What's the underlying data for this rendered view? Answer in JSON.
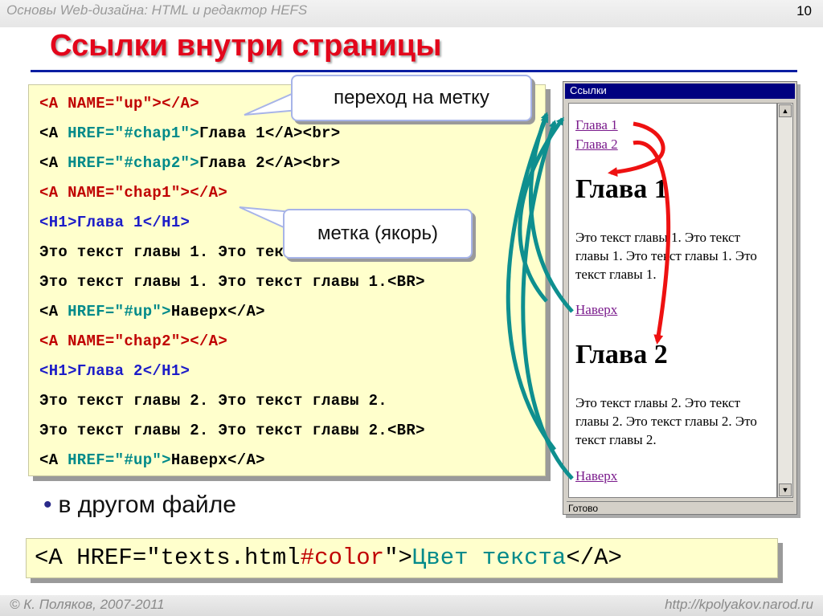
{
  "header": {
    "course": "Основы Web-дизайна: HTML и редактор HEFS",
    "slide_number": "10"
  },
  "title": "Ссылки внутри страницы",
  "code": {
    "l1": {
      "a": "<A NAME=\"up\"></A>"
    },
    "l2": {
      "a": "<A ",
      "b": "HREF=\"#chap1\">",
      "c": "Глава 1</A><br>"
    },
    "l3": {
      "a": "<A ",
      "b": "HREF=\"#chap2\">",
      "c": "Глава 2</A><br>"
    },
    "l4": {
      "a": "<A NAME=\"chap1\"></A>"
    },
    "l5": {
      "a": "<H1>Глава 1</H1>"
    },
    "l6": {
      "a": "Это текст главы 1. Это текст главы 1."
    },
    "l7": {
      "a": "Это текст главы 1. Это текст главы 1.<BR>"
    },
    "l8": {
      "a": "<A ",
      "b": "HREF=\"#up\">",
      "c": "Наверх</A>"
    },
    "l9": {
      "a": "<A NAME=\"chap2\"></A>"
    },
    "l10": {
      "a": "<H1>Глава 2</H1>"
    },
    "l11": {
      "a": "Это текст главы 2. Это текст главы 2."
    },
    "l12": {
      "a": "Это текст главы 2. Это текст главы 2.<BR>"
    },
    "l13": {
      "a": "<A ",
      "b": "HREF=\"#up\">",
      "c": "Наверх</A>"
    }
  },
  "callouts": {
    "jump": "переход на метку",
    "anchor": "метка (якорь)"
  },
  "browser": {
    "title": "Ссылки",
    "link1": "Глава 1",
    "link2": "Глава 2",
    "h1_1": "Глава 1",
    "para1": "Это текст главы 1. Это текст главы 1. Это текст главы 1. Это текст главы 1.",
    "up1": "Наверх",
    "h1_2": "Глава 2",
    "para2": "Это текст главы 2. Это текст главы 2. Это текст главы 2. Это текст главы 2.",
    "up2": "Наверх",
    "status": "Готово"
  },
  "bullet": "в другом файле",
  "code2": {
    "a": "<A ",
    "b": "HREF=\"texts.html",
    "c": "#color",
    "d": "\">",
    "e": "Цвет текста",
    "f": "</A>"
  },
  "footer": {
    "copyright": "© К. Поляков, 2007-2011",
    "site": "http://kpolyakov.narod.ru"
  },
  "colors": {
    "title": "#e3061b",
    "code_bg": "#ffffcc",
    "attr_teal": "#008a8a",
    "tag_red": "#c00000",
    "tag_blue": "#1c1cc8",
    "arrow_teal": "#0e8f8f",
    "arrow_red": "#ee1111"
  }
}
